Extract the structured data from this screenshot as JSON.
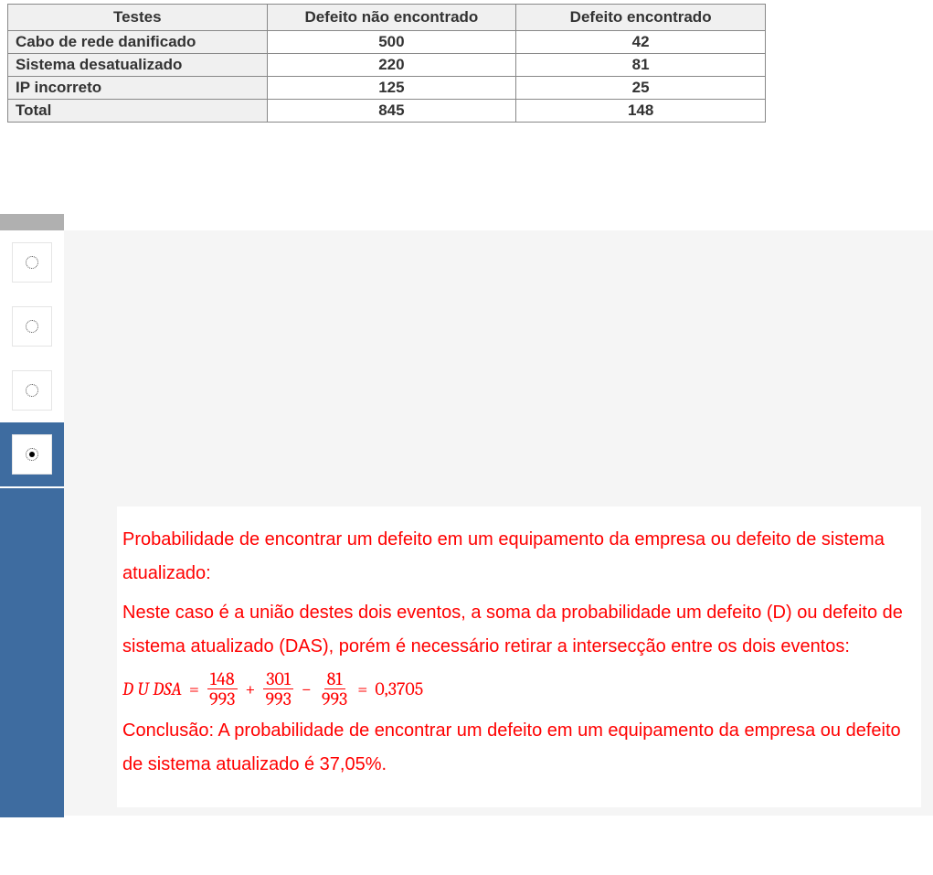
{
  "table": {
    "headers": [
      "Testes",
      "Defeito não encontrado",
      "Defeito encontrado"
    ],
    "rows": [
      {
        "label": "Cabo de rede danificado",
        "nf": "500",
        "f": "42"
      },
      {
        "label": "Sistema desatualizado",
        "nf": "220",
        "f": "81"
      },
      {
        "label": "IP incorreto",
        "nf": "125",
        "f": "25"
      },
      {
        "label": "Total",
        "nf": "845",
        "f": "148"
      }
    ]
  },
  "answer": {
    "p1": "Probabilidade de encontrar um defeito em um equipamento da empresa ou defeito de sistema atualizado:",
    "p2": "Neste caso é a união destes dois eventos, a soma da probabilidade um defeito (D) ou defeito de sistema atualizado (DAS), porém é necessário retirar a intersecção entre os dois eventos:",
    "formula": {
      "lhs": "D U DSA",
      "eq": "=",
      "f1_num": "148",
      "f1_den": "993",
      "plus": "+",
      "f2_num": "301",
      "f2_den": "993",
      "minus": "−",
      "f3_num": "81",
      "f3_den": "993",
      "eq2": "=",
      "result": "0,3705"
    },
    "p3": "Conclusão: A probabilidade de encontrar um defeito em um equipamento da empresa ou defeito de sistema atualizado é 37,05%."
  },
  "chart_data": {
    "type": "table",
    "title": "Testes × Defeito",
    "columns": [
      "Testes",
      "Defeito não encontrado",
      "Defeito encontrado"
    ],
    "rows": [
      [
        "Cabo de rede danificado",
        500,
        42
      ],
      [
        "Sistema desatualizado",
        220,
        81
      ],
      [
        "IP incorreto",
        125,
        25
      ],
      [
        "Total",
        845,
        148
      ]
    ]
  }
}
